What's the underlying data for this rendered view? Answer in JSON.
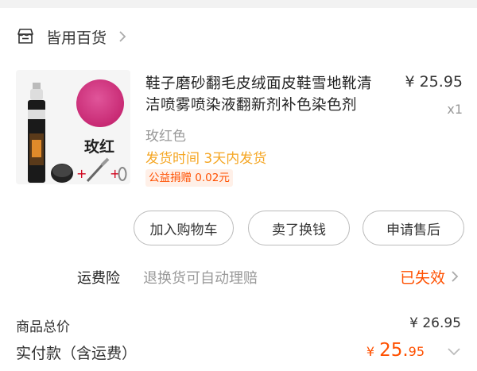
{
  "store": {
    "name": "皆用百货",
    "icon": "store-icon"
  },
  "product": {
    "thumb_label": "玫红",
    "title": "鞋子磨砂翻毛皮绒面皮鞋雪地靴清洁喷雾喷染液翻新剂补色染色剂",
    "price": "¥ 25.95",
    "quantity": "x1",
    "sku": "玫红色",
    "shipping": "发货时间  3天内发货",
    "charity": "公益捐赠 0.02元",
    "swatch_color": "#d23f84"
  },
  "actions": {
    "add_to_cart": "加入购物车",
    "sell_for_cash": "卖了换钱",
    "after_sales": "申请售后"
  },
  "insurance": {
    "label": "运费险",
    "description": "退换货可自动理赔",
    "status": "已失效"
  },
  "totals": {
    "goods_label": "商品总价",
    "goods_value": "¥ 26.95",
    "paid_label": "实付款（含运费）",
    "paid_currency": "¥",
    "paid_int": "25.",
    "paid_dec": "95"
  },
  "colors": {
    "accent": "#ff5000",
    "shipping": "#f5a623",
    "muted": "#999999"
  }
}
